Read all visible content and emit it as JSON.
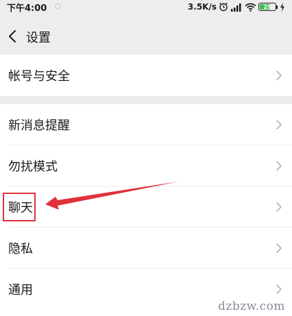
{
  "status_bar": {
    "time": "下午4:00",
    "network_speed": "3.5K/s",
    "battery_level": "29",
    "icons": [
      "alarm-icon",
      "signal-icon",
      "wifi-icon",
      "battery-icon",
      "charging-icon"
    ]
  },
  "nav": {
    "title": "设置",
    "back_icon": "chevron-left-icon"
  },
  "groups": [
    {
      "items": [
        {
          "label": "帐号与安全"
        }
      ]
    },
    {
      "items": [
        {
          "label": "新消息提醒"
        },
        {
          "label": "勿扰模式"
        },
        {
          "label": "聊天"
        },
        {
          "label": "隐私"
        },
        {
          "label": "通用"
        }
      ]
    }
  ],
  "annotation": {
    "highlight_target": "聊天",
    "color": "#e0323a"
  },
  "watermark": "dzbzw.com"
}
